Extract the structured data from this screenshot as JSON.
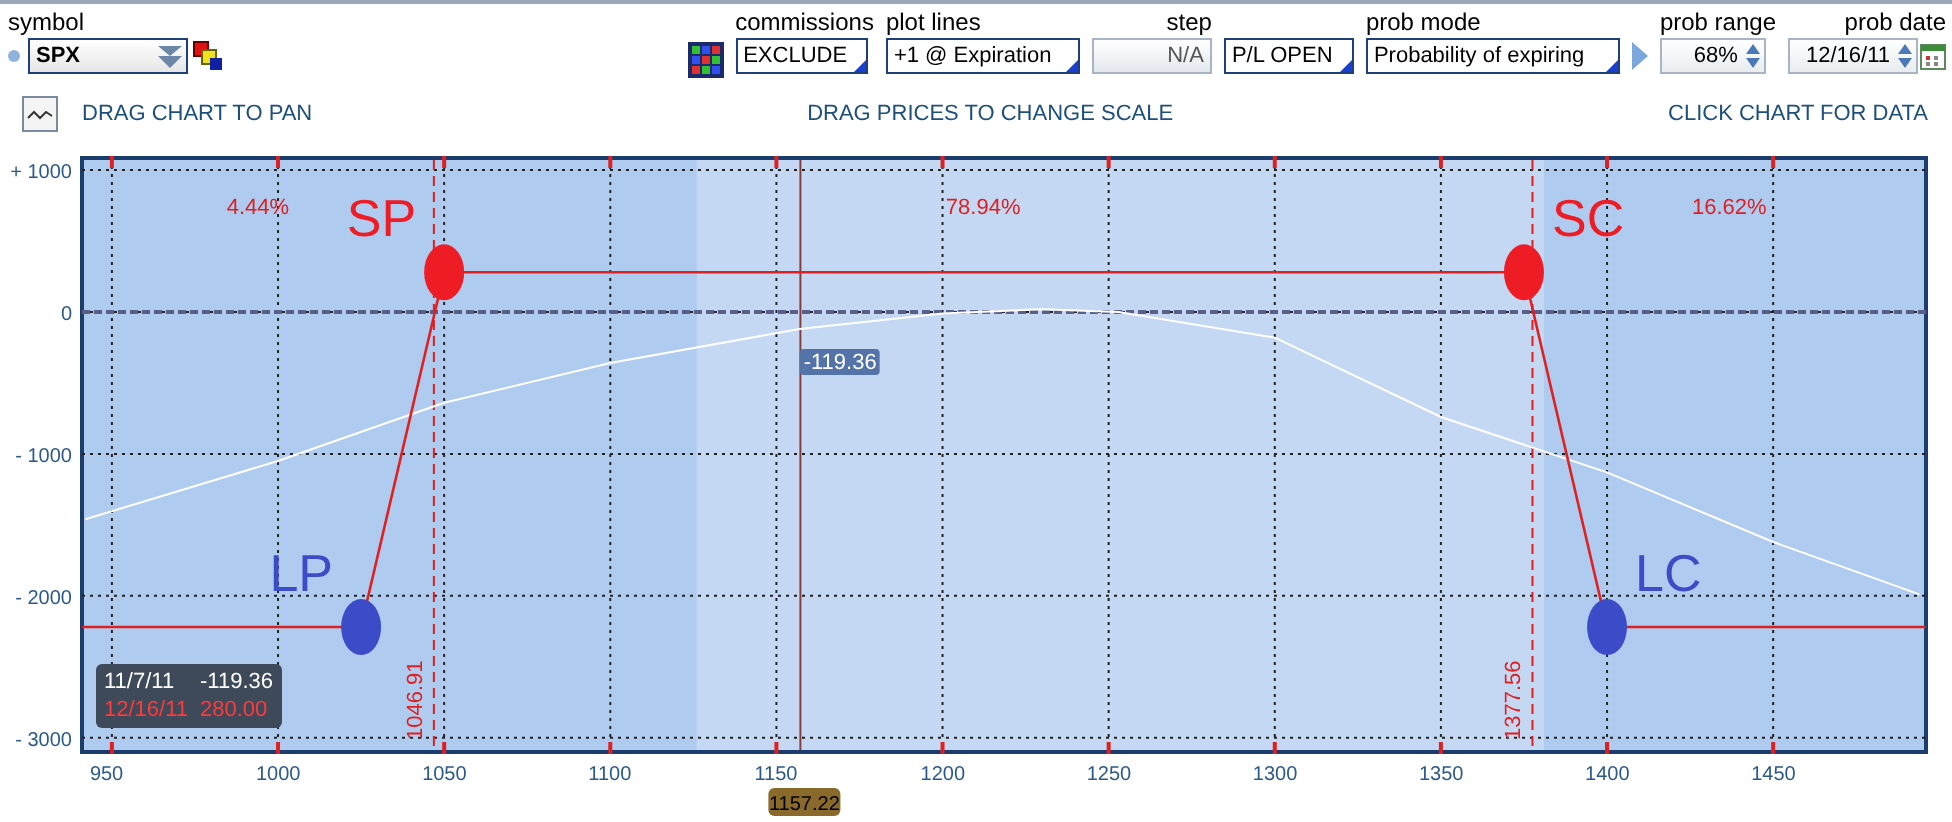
{
  "toolbar": {
    "symbol": {
      "label": "symbol",
      "value": "SPX"
    },
    "controls": [
      {
        "kind": "dropdown",
        "label": "commissions",
        "value": "EXCLUDE"
      },
      {
        "kind": "dropdown",
        "label": "plot lines",
        "value": "+1 @ Expiration"
      },
      {
        "kind": "readonly",
        "label": "step",
        "value": "N/A",
        "disabled": true
      },
      {
        "kind": "dropdown",
        "value": "P/L OPEN"
      },
      {
        "kind": "dropdown",
        "label": "prob mode",
        "value": "Probability of expiring"
      },
      {
        "kind": "spinner",
        "label": "prob range",
        "value": "68%"
      },
      {
        "kind": "date",
        "label": "prob date",
        "value": "12/16/11"
      }
    ]
  },
  "hints": [
    "DRAG CHART TO PAN",
    "DRAG PRICES TO CHANGE SCALE",
    "CLICK CHART FOR DATA"
  ],
  "chart": {
    "chart_data": {
      "type": "line",
      "grid": true,
      "xlim": [
        941,
        1496
      ],
      "ylim": [
        -3100,
        1085
      ],
      "xticks": [
        950,
        1000,
        1050,
        1100,
        1150,
        1200,
        1250,
        1300,
        1350,
        1400,
        1450
      ],
      "yticks": [
        {
          "value": 1000,
          "label": "+ 1000"
        },
        {
          "value": 0,
          "label": "0"
        },
        {
          "value": -1000,
          "label": "- 1000"
        },
        {
          "value": -2000,
          "label": "- 2000"
        },
        {
          "value": -3000,
          "label": "- 3000"
        }
      ],
      "series": [
        {
          "color": "#ffffff",
          "x": [
            942,
            1000,
            1050,
            1100,
            1157,
            1200,
            1230,
            1253,
            1300,
            1350,
            1400,
            1450,
            1494
          ],
          "values": [
            -1460,
            -1050,
            -640,
            -360,
            -120,
            -10,
            20,
            0,
            -180,
            -740,
            -1130,
            -1620,
            -1990
          ]
        },
        {
          "color": "#e02020",
          "x": [
            941,
            1025,
            1050,
            1375,
            1400,
            1496
          ],
          "values": [
            -2220,
            -2220,
            280,
            280,
            -2220,
            -2220
          ]
        }
      ],
      "bands": [
        {
          "axis": "x",
          "from": 1126,
          "to": 1381,
          "color": "#c4d8f4"
        }
      ],
      "ref_lines": [
        {
          "axis": "y",
          "value": 0,
          "color": "#5a5f8a"
        },
        {
          "axis": "x",
          "value": 1046.91,
          "label": "1046.91",
          "color": "#e02020"
        },
        {
          "axis": "x",
          "value": 1377.56,
          "label": "1377.56",
          "color": "#e02020"
        },
        {
          "axis": "x",
          "value": 1157.22,
          "label": "1157.22",
          "color": "#8b3a3a"
        }
      ],
      "annotations": [
        "4.44%",
        "78.94%",
        "16.62%",
        {
          "x": 1050,
          "y": 280,
          "text": "SP"
        },
        {
          "x": 1375,
          "y": 280,
          "text": "SC"
        },
        {
          "x": 1025,
          "y": -2220,
          "text": "LP"
        },
        {
          "x": 1400,
          "y": -2220,
          "text": "LC"
        },
        {
          "x": 1157,
          "y": -120,
          "text": "-119.36"
        }
      ]
    },
    "tooltip": [
      {
        "date": "11/7/11",
        "value": "-119.36",
        "color": "#ffffff"
      },
      {
        "date": "12/16/11",
        "value": "280.00",
        "color": "#ff3a3a"
      }
    ]
  }
}
